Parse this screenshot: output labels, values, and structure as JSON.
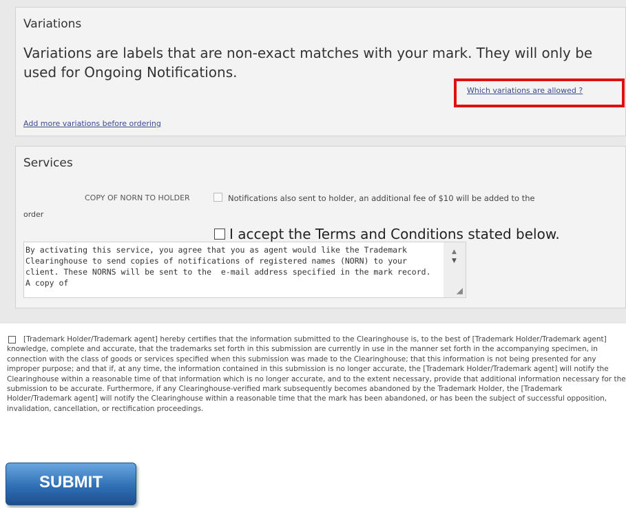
{
  "variations": {
    "title": "Variations",
    "description": "Variations are labels that are non-exact matches with your mark. They will only be used for Ongoing Notifications.",
    "which_link": "Which variations are allowed ?",
    "add_more_link": "Add more variations before ordering",
    "highlight_color": "#e01010"
  },
  "services": {
    "title": "Services",
    "norn_label": "COPY OF NORN TO HOLDER",
    "norn_desc": "Notifications also sent to holder, an additional fee of $10 will be added to the",
    "norn_desc_cont": "order",
    "accept_label": "I accept the Terms and Conditions stated below.",
    "terms_text": "By activating this service, you agree that you as agent would like the Trademark Clearinghouse to send copies of notifications of registered names (NORN) to your client. These NORNS will be sent to the  e-mail address specified in the mark record. A copy of"
  },
  "certification": {
    "text": "[Trademark Holder/Trademark agent] hereby certifies that the information submitted to the Clearinghouse is, to the best of [Trademark Holder/Trademark agent] knowledge, complete and accurate, that the trademarks set forth in this submission are currently in use in the manner set forth in the accompanying specimen, in connection with the class of goods or services specified when this submission was made to the Clearinghouse; that this information is not being presented for any improper purpose; and that if, at any time, the information contained in this submission is no longer accurate, the [Trademark Holder/Trademark agent] will notify the Clearinghouse within a reasonable time of that information which is no longer accurate, and to the extent necessary, provide that additional information necessary for the submission to be accurate. Furthermore, if any Clearinghouse-verified mark subsequently becomes abandoned by the Trademark Holder, the [Trademark Holder/Trademark agent] will notify the Clearinghouse within a reasonable time that the mark has been abandoned, or has been the subject of successful opposition, invalidation, cancellation, or rectification proceedings."
  },
  "submit": {
    "label": "SUBMIT",
    "color": "#2f70b6"
  },
  "icons": {
    "scroll_up": "▲",
    "scroll_down": "▼",
    "resize": "◢"
  }
}
